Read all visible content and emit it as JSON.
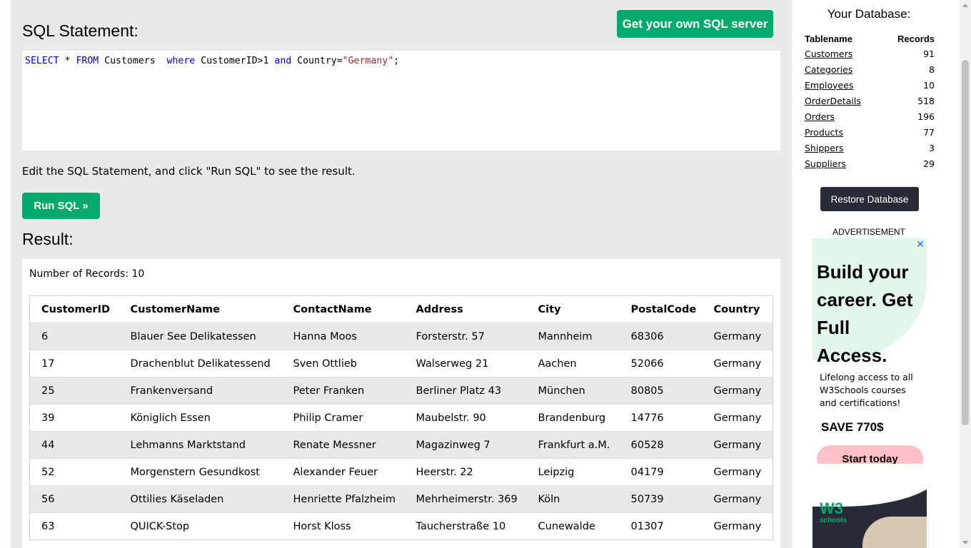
{
  "main": {
    "sql_title": "SQL Statement:",
    "own_server_label": "Get your own SQL server",
    "sql": {
      "kw_select": "SELECT",
      "star": " * ",
      "kw_from": "FROM",
      "table": " Customers  ",
      "kw_where": "where",
      "cond1": " CustomerID>1 ",
      "kw_and": "and",
      "cond2": " Country=",
      "value": "\"Germany\"",
      "end": ";"
    },
    "hint": "Edit the SQL Statement, and click \"Run SQL\" to see the result.",
    "run_label": "Run SQL »",
    "result_title": "Result:",
    "records_text": "Number of Records: 10",
    "columns": [
      "CustomerID",
      "CustomerName",
      "ContactName",
      "Address",
      "City",
      "PostalCode",
      "Country"
    ],
    "rows": [
      [
        "6",
        "Blauer See Delikatessen",
        "Hanna Moos",
        "Forsterstr. 57",
        "Mannheim",
        "68306",
        "Germany"
      ],
      [
        "17",
        "Drachenblut Delikatessend",
        "Sven Ottlieb",
        "Walserweg 21",
        "Aachen",
        "52066",
        "Germany"
      ],
      [
        "25",
        "Frankenversand",
        "Peter Franken",
        "Berliner Platz 43",
        "München",
        "80805",
        "Germany"
      ],
      [
        "39",
        "Königlich Essen",
        "Philip Cramer",
        "Maubelstr. 90",
        "Brandenburg",
        "14776",
        "Germany"
      ],
      [
        "44",
        "Lehmanns Marktstand",
        "Renate Messner",
        "Magazinweg 7",
        "Frankfurt a.M.",
        "60528",
        "Germany"
      ],
      [
        "52",
        "Morgenstern Gesundkost",
        "Alexander Feuer",
        "Heerstr. 22",
        "Leipzig",
        "04179",
        "Germany"
      ],
      [
        "56",
        "Ottilies Käseladen",
        "Henriette Pfalzheim",
        "Mehrheimerstr. 369",
        "Köln",
        "50739",
        "Germany"
      ],
      [
        "63",
        "QUICK-Stop",
        "Horst Kloss",
        "Taucherstraße 10",
        "Cunewalde",
        "01307",
        "Germany"
      ]
    ]
  },
  "sidebar": {
    "title": "Your Database:",
    "col_tablename": "Tablename",
    "col_records": "Records",
    "tables": [
      {
        "name": "Customers",
        "records": "91"
      },
      {
        "name": "Categories",
        "records": "8"
      },
      {
        "name": "Employees",
        "records": "10"
      },
      {
        "name": "OrderDetails",
        "records": "518"
      },
      {
        "name": "Orders",
        "records": "196"
      },
      {
        "name": "Products",
        "records": "77"
      },
      {
        "name": "Shippers",
        "records": "3"
      },
      {
        "name": "Suppliers",
        "records": "29"
      }
    ],
    "restore_label": "Restore Database",
    "ad_label": "ADVERTISEMENT",
    "ad": {
      "close": "✕",
      "headline": "Build your career. Get Full Access.",
      "text": "Lifelong access to all W3Schools courses and certifications!",
      "save": "SAVE 770$",
      "cta": "Start today",
      "logo": "W3",
      "logo_sub": "schools"
    }
  },
  "colors": {
    "accent": "#04aa6d",
    "panel_bg": "#e7e9eb",
    "dark_button": "#282a35",
    "sql_keyword": "#0000cd",
    "sql_string": "#a52a2a"
  }
}
